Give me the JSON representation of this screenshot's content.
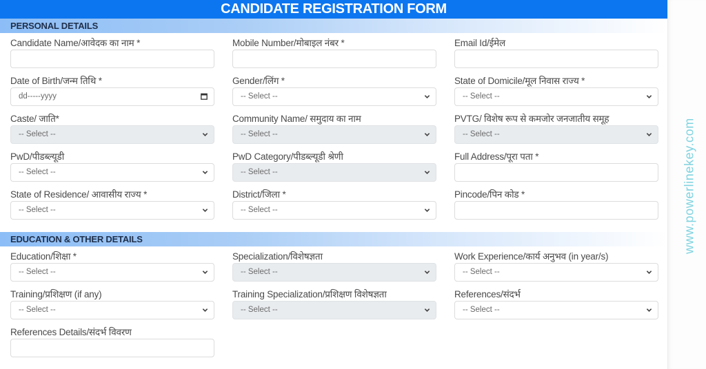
{
  "form": {
    "title": "CANDIDATE REGISTRATION FORM",
    "watermark": "www.powerlinekey.com"
  },
  "sections": {
    "personal": {
      "title": "PERSONAL DETAILS",
      "fields": {
        "candidate_name": {
          "label": "Candidate Name/आवेदक का नाम *",
          "value": ""
        },
        "mobile_number": {
          "label": "Mobile Number/मोबाइल नंबर *",
          "value": ""
        },
        "email": {
          "label": "Email Id/ईमेल",
          "value": ""
        },
        "dob": {
          "label": "Date of Birth/जन्म तिथि *",
          "placeholder": "dd-----yyyy",
          "icon": "calendar-icon"
        },
        "gender": {
          "label": "Gender/लिंग *",
          "selected": "-- Select --"
        },
        "state_domicile": {
          "label": "State of Domicile/मूल निवास राज्य *",
          "selected": "-- Select --"
        },
        "caste": {
          "label": "Caste/ जाति*",
          "selected": "-- Select --",
          "disabled": true
        },
        "community_name": {
          "label": "Community Name/ समुदाय का नाम",
          "selected": "-- Select --",
          "disabled": true
        },
        "pvtg": {
          "label": "PVTG/ विशेष रूप से कमजोर जनजातीय समूह",
          "selected": "-- Select --",
          "disabled": true
        },
        "pwd": {
          "label": "PwD/पीडब्ल्यूडी",
          "selected": "-- Select --"
        },
        "pwd_category": {
          "label": "PwD Category/पीडब्ल्यूडी श्रेणी",
          "selected": "-- Select --",
          "disabled": true
        },
        "full_address": {
          "label": "Full Address/पूरा पता *",
          "value": ""
        },
        "state_residence": {
          "label": "State of Residence/ आवासीय राज्य *",
          "selected": "-- Select --"
        },
        "district": {
          "label": "District/जिला *",
          "selected": "-- Select --"
        },
        "pincode": {
          "label": "Pincode/पिन कोड *",
          "value": ""
        }
      }
    },
    "education": {
      "title": "EDUCATION & OTHER DETAILS",
      "fields": {
        "education": {
          "label": "Education/शिक्षा *",
          "selected": "-- Select --"
        },
        "specialization": {
          "label": "Specialization/विशेषज्ञता",
          "selected": "-- Select --",
          "disabled": true
        },
        "work_experience": {
          "label": "Work Experience/कार्य अनुभव (in year/s)",
          "selected": "-- Select --"
        },
        "training": {
          "label": "Training/प्रशिक्षण (if any)",
          "selected": "-- Select --"
        },
        "training_specialization": {
          "label": "Training Specialization/प्रशिक्षण विशेषज्ञता",
          "selected": "-- Select --",
          "disabled": true
        },
        "references": {
          "label": "References/संदर्भ",
          "selected": "-- Select --"
        },
        "references_details": {
          "label": "References Details/संदर्भ विवरण",
          "value": ""
        }
      }
    }
  },
  "colors": {
    "title_bar": "#0c76f0",
    "section_bar_start": "#8cbdf6",
    "disabled_field": "#e9ecef",
    "watermark": "#7fd3e0"
  }
}
